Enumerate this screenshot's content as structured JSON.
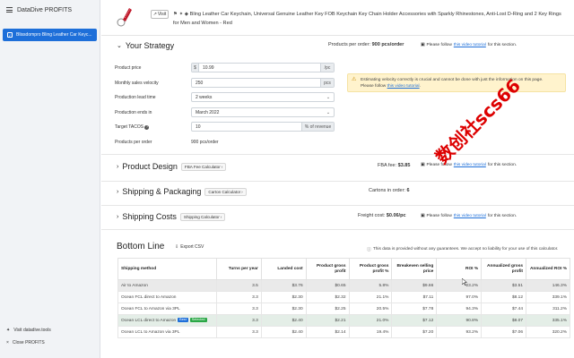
{
  "app": {
    "title": "DataDive PROFITS",
    "active_item": "Blissdompro Bling Leather Car Keyc...",
    "footer_links": [
      "Visit datadive.tools",
      "Close PROFITS"
    ]
  },
  "product": {
    "visit_label": "Visit",
    "title": "Bling Leather Car Keychain, Universal Genuine Leather Key FOB Keychain Key Chain Holder Accessories with Sparkly Rhinestones, Anti-Lost D-Ring and 2 Key Rings for Men and Women - Red"
  },
  "strategy": {
    "title": "Your Strategy",
    "products_per_order_label": "Products per order:",
    "products_per_order_value": "900 pcs/order",
    "tutorial_prefix": "Please follow",
    "tutorial_link": "this video tutorial",
    "tutorial_suffix": "for this section.",
    "fields": [
      {
        "label": "Product price",
        "prefix": "$",
        "value": "10.99",
        "suffix": "/pc"
      },
      {
        "label": "Monthly sales velocity",
        "value": "250",
        "suffix": "pcs"
      },
      {
        "label": "Production lead time",
        "value": "2 weeks",
        "select": true
      },
      {
        "label": "Production ends in",
        "value": "March 2022",
        "select": true
      },
      {
        "label": "Target TACOS",
        "value": "10",
        "suffix": "% of revenue",
        "info": true
      }
    ],
    "products_per_order_row": {
      "label": "Products per order",
      "value": "900 pcs/order"
    },
    "warning": {
      "text": "Estimating velocity correctly is crucial and cannot be done with just the information on this page.",
      "prefix": "Please follow",
      "link": "this video tutorial",
      "suffix": "."
    }
  },
  "product_design": {
    "title": "Product Design",
    "button": "FBA Fee Calculator",
    "info_label": "FBA fee:",
    "info_value": "$3.85",
    "tutorial_prefix": "Please follow",
    "tutorial_link": "this video tutorial",
    "tutorial_suffix": "for this section."
  },
  "shipping_packaging": {
    "title": "Shipping & Packaging",
    "button": "Carton Calculator",
    "info_label": "Cartons in order:",
    "info_value": "6"
  },
  "shipping_costs": {
    "title": "Shipping Costs",
    "button": "Shipping Calculator",
    "info_label": "Freight cost:",
    "info_value": "$0.06/pc",
    "tutorial_prefix": "Please follow",
    "tutorial_link": "this video tutorial",
    "tutorial_suffix": "for this section."
  },
  "bottom_line": {
    "title": "Bottom Line",
    "export": "Export CSV",
    "disclaimer": "This data is provided without any guarantees. We accept no liability for your use of this calculator.",
    "headers": [
      "Shipping method",
      "Turns per year",
      "Landed cost",
      "Product gross profit",
      "Product gross profit %",
      "Breakeven selling price",
      "ROI %",
      "Annualized gross profit",
      "Annualized ROI %"
    ],
    "rows": [
      {
        "method": "Air to Amazon",
        "turns": "3.5",
        "landed": "$3.76",
        "gp": "$0.65",
        "gpp": "5.8%",
        "be": "$9.66",
        "roi": "23.2%",
        "agp": "$3.51",
        "aroi": "146.3%",
        "style": "gray"
      },
      {
        "method": "Ocean FCL direct to Amazon",
        "turns": "3.3",
        "landed": "$2.30",
        "gp": "$2.32",
        "gpp": "21.1%",
        "be": "$7.11",
        "roi": "97.0%",
        "agp": "$8.12",
        "aroi": "339.1%",
        "style": ""
      },
      {
        "method": "Ocean FCL to Amazon via 3PL",
        "turns": "3.3",
        "landed": "$2.30",
        "gp": "$2.25",
        "gpp": "20.5%",
        "be": "$7.78",
        "roi": "94.3%",
        "agp": "$7.44",
        "aroi": "311.2%",
        "style": ""
      },
      {
        "method": "Ocean LCL direct to Amazon",
        "turns": "3.3",
        "landed": "$2.40",
        "gp": "$2.21",
        "gpp": "21.0%",
        "be": "$7.12",
        "roi": "90.8%",
        "agp": "$8.07",
        "aroi": "335.1%",
        "style": "sel",
        "badges": [
          "Best",
          "Selected"
        ]
      },
      {
        "method": "Ocean LCL to Amazon via 3PL",
        "turns": "3.3",
        "landed": "$2.40",
        "gp": "$2.14",
        "gpp": "19.4%",
        "be": "$7.20",
        "roi": "93.2%",
        "agp": "$7.06",
        "aroi": "320.2%",
        "style": ""
      }
    ]
  },
  "watermark": "数创社scs66",
  "colors": {
    "primary": "#1e6fd9",
    "sidebar_bg": "#f1f3f6",
    "warning_bg": "#fff3cd",
    "selected_row": "#e4eee7",
    "success": "#29a745"
  }
}
